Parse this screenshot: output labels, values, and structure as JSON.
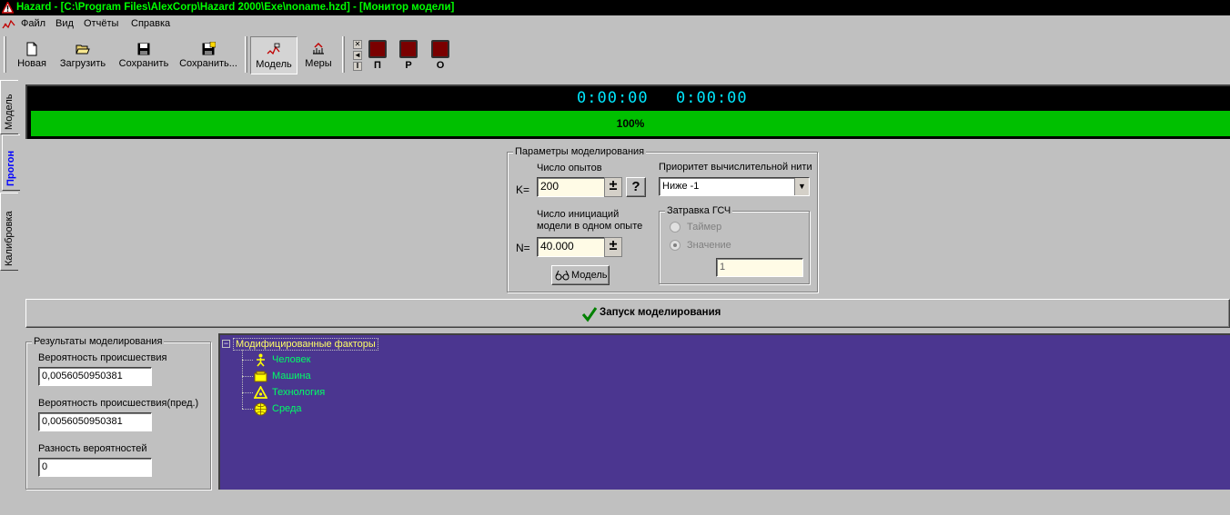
{
  "window": {
    "title": "Hazard - [C:\\Program Files\\AlexCorp\\Hazard 2000\\Exe\\noname.hzd] - [Монитор модели]"
  },
  "menu": {
    "items": [
      "Файл",
      "Вид",
      "Отчёты",
      "Справка"
    ]
  },
  "toolbar": {
    "new_label": "Новая",
    "load_label": "Загрузить",
    "save_label": "Сохранить",
    "save_as_label": "Сохранить...",
    "model_label": "Модель",
    "measures_label": "Меры",
    "red_buttons": [
      "П",
      "Р",
      "О"
    ]
  },
  "left_tabs": {
    "model": "Модель",
    "run": "Прогон",
    "calibration": "Калибровка"
  },
  "timer": {
    "elapsed": "0:00:00",
    "remaining": "0:00:00",
    "progress_text": "100%",
    "progress_fraction": 1.0
  },
  "params": {
    "group_title": "Параметры моделирования",
    "trials_label": "Число опытов",
    "k_prefix": "K=",
    "k_value": "200",
    "help_symbol": "?",
    "initiations_label_line1": "Число инициаций",
    "initiations_label_line2": "модели в одном опыте",
    "n_prefix": "N=",
    "n_value": "40.000",
    "model_button_label": "Модель",
    "priority_label": "Приоритет вычислительной нити",
    "priority_value": "Ниже -1",
    "seed_group_title": "Затравка ГСЧ",
    "seed_timer_label": "Таймер",
    "seed_value_label": "Значение",
    "seed_value": "1"
  },
  "run_button_label": "Запуск моделирования",
  "results": {
    "group_title": "Результаты моделирования",
    "prob_label": "Вероятность происшествия",
    "prob_value": "0,0056050950381",
    "prob_pred_label": "Вероятность происшествия(пред.)",
    "prob_pred_value": "0,0056050950381",
    "diff_label": "Разность вероятностей",
    "diff_value": "0"
  },
  "tree": {
    "root": "Модифицированные факторы",
    "children": [
      "Человек",
      "Машина",
      "Технология",
      "Среда"
    ]
  },
  "colors": {
    "title_bg": "#000000",
    "title_fg": "#00ff00",
    "timer_fg": "#00e8ff",
    "progress": "#00c000",
    "tree_bg": "#4b3690",
    "tree_root_fg": "#ffff66",
    "tree_child_fg": "#00ff66"
  }
}
